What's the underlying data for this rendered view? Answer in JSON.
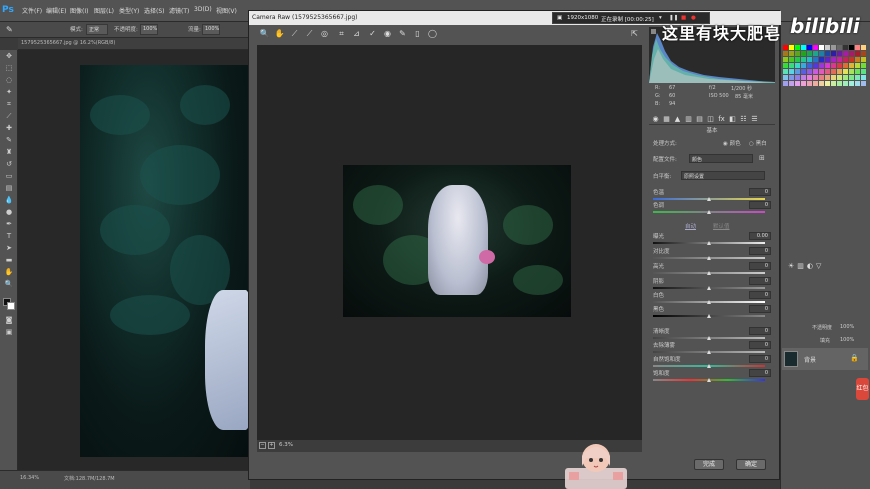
{
  "menubar": {
    "logo": "Ps",
    "items": [
      "文件(F)",
      "编辑(E)",
      "图像(I)",
      "图层(L)",
      "类型(Y)",
      "选择(S)",
      "滤镜(T)",
      "3D(D)",
      "视图(V)"
    ]
  },
  "optionsbar": {
    "mode_label": "模式:",
    "mode_value": "正常",
    "opacity_label": "不透明度:",
    "opacity_value": "100%",
    "flow_label": "流量:",
    "flow_value": "100%"
  },
  "document": {
    "tab_title": "1579525365667.jpg @ 16.2%(RGB/8)",
    "status_zoom": "16.34%",
    "status_doc": "文档:128.7M/128.7M"
  },
  "camera_raw": {
    "title": "Camera Raw (1579525365667.jpg)",
    "zoom": "6.3%",
    "rgb": {
      "r_label": "R:",
      "g_label": "G:",
      "b_label": "B:",
      "r": "67",
      "g": "60",
      "b": "94"
    },
    "exif": {
      "aperture": "f/2",
      "shutter": "1/200 秒",
      "iso": "ISO 500",
      "focal": "85 毫米"
    },
    "panel_title": "基本",
    "treatment_label": "处理方式:",
    "treatment_color": "颜色",
    "treatment_bw": "黑白",
    "profile_label": "配置文件:",
    "profile_value": "颜色",
    "wb_label": "白平衡:",
    "wb_value": "原照设置",
    "auto_label": "自动",
    "default_label": "默认值",
    "sliders": [
      {
        "label": "色温",
        "value": "0",
        "pos": 0.5,
        "gradient": "linear-gradient(90deg,#3a6bd8,#e8d74a)"
      },
      {
        "label": "色调",
        "value": "0",
        "pos": 0.5,
        "gradient": "linear-gradient(90deg,#3bb84a,#c84ac8)"
      },
      {
        "label": "曝光",
        "value": "0.00",
        "pos": 0.5,
        "gradient": "linear-gradient(90deg,#111,#eee)"
      },
      {
        "label": "对比度",
        "value": "0",
        "pos": 0.5,
        "gradient": "linear-gradient(90deg,#555,#ccc)"
      },
      {
        "label": "高光",
        "value": "0",
        "pos": 0.5,
        "gradient": "linear-gradient(90deg,#555,#ccc)"
      },
      {
        "label": "阴影",
        "value": "0",
        "pos": 0.5,
        "gradient": "linear-gradient(90deg,#111,#999)"
      },
      {
        "label": "白色",
        "value": "0",
        "pos": 0.5,
        "gradient": "linear-gradient(90deg,#555,#fff)"
      },
      {
        "label": "黑色",
        "value": "0",
        "pos": 0.5,
        "gradient": "linear-gradient(90deg,#000,#888)"
      },
      {
        "label": "清晰度",
        "value": "0",
        "pos": 0.5,
        "gradient": "linear-gradient(90deg,#444,#bbb)"
      },
      {
        "label": "去除薄雾",
        "value": "0",
        "pos": 0.5,
        "gradient": "linear-gradient(90deg,#444,#bbb)"
      },
      {
        "label": "自然饱和度",
        "value": "0",
        "pos": 0.5,
        "gradient": "linear-gradient(90deg,#888,#3b9,#c33)"
      },
      {
        "label": "饱和度",
        "value": "0",
        "pos": 0.5,
        "gradient": "linear-gradient(90deg,#888,#e33,#3b3,#33e)"
      }
    ],
    "btn_done": "完成",
    "btn_ok": "确定"
  },
  "layers": {
    "layer_name": "背景",
    "mode_value": "不透明度",
    "opacity_value": "100%",
    "fill_label": "填充",
    "fill_value": "100%"
  },
  "side_tab": "红包",
  "recording": {
    "resolution": "1920x1080",
    "status": "正在录制 [00:00:25]"
  },
  "watermark": "这里有块大肥皂",
  "brand": "bilibili"
}
